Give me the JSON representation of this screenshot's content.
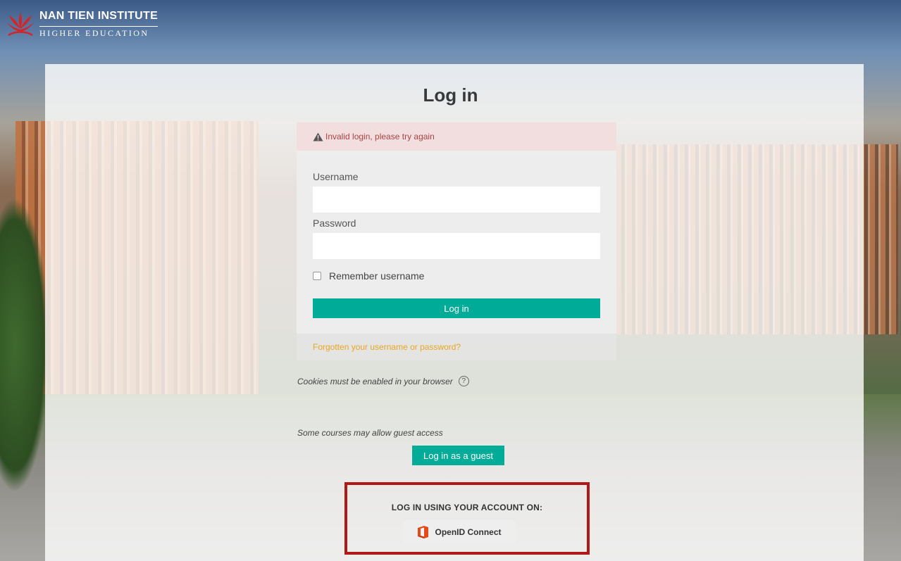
{
  "brand": {
    "name_line1": "NAN TIEN INSTITUTE",
    "name_line2": "HIGHER EDUCATION"
  },
  "page": {
    "title": "Log in"
  },
  "alert": {
    "message": "Invalid login, please try again",
    "icon": "warning-icon"
  },
  "form": {
    "username_label": "Username",
    "username_value": "",
    "password_label": "Password",
    "password_value": "",
    "remember_label": "Remember username",
    "remember_checked": false,
    "submit_label": "Log in",
    "forgot_link": "Forgotten your username or password?"
  },
  "cookies": {
    "text": "Cookies must be enabled in your browser",
    "help_icon": "question-circle-icon"
  },
  "guest": {
    "text": "Some courses may allow guest access",
    "button_label": "Log in as a guest"
  },
  "sso": {
    "heading": "LOG IN USING YOUR ACCOUNT ON:",
    "provider_label": "OpenID Connect",
    "provider_icon": "office-icon"
  },
  "colors": {
    "primary_button": "#00ab98",
    "alert_bg": "#f2dede",
    "alert_text": "#a94442",
    "link": "#e8a623",
    "highlight_border": "#b11919"
  }
}
